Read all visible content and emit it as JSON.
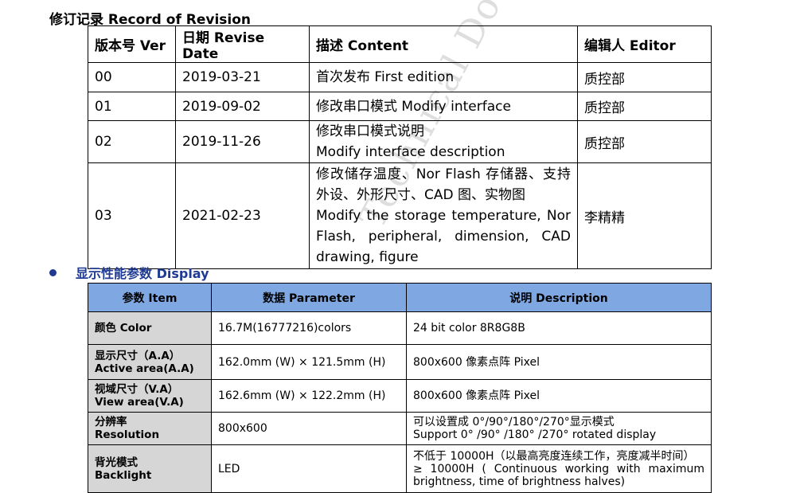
{
  "revision": {
    "title": "修订记录 Record of Revision",
    "headers": [
      "版本号 Ver",
      "日期 Revise Date",
      "描述 Content",
      "编辑人 Editor"
    ],
    "rows": [
      {
        "ver": "00",
        "date": "2019-03-21",
        "content": [
          "首次发布 First edition"
        ],
        "editor": "质控部"
      },
      {
        "ver": "01",
        "date": "2019-09-02",
        "content": [
          "修改串口模式 Modify interface"
        ],
        "editor": "质控部"
      },
      {
        "ver": "02",
        "date": "2019-11-26",
        "content": [
          "修改串口模式说明",
          "Modify interface description"
        ],
        "editor": "质控部"
      },
      {
        "ver": "03",
        "date": "2021-02-23",
        "content": [
          "修改储存温度、Nor Flash 存储器、支持外设、外形尺寸、CAD 图、实物图",
          "Modify the storage temperature, Nor Flash, peripheral, dimension, CAD drawing, figure"
        ],
        "editor": "李精精"
      }
    ]
  },
  "display": {
    "title": "显示性能参数 Display",
    "headers": [
      "参数 Item",
      "数据 Parameter",
      "说明 Description"
    ],
    "rows": [
      {
        "item": [
          "颜色 Color"
        ],
        "param": "16.7M(16777216)colors",
        "desc": [
          "24 bit color 8R8G8B"
        ]
      },
      {
        "item": [
          "显示尺寸（A.A）",
          "Active area(A.A)"
        ],
        "param": "162.0mm (W) × 121.5mm (H)",
        "desc": [
          "800x600 像素点阵 Pixel"
        ]
      },
      {
        "item": [
          "视域尺寸（V.A）",
          "View area(V.A)"
        ],
        "param": "162.6mm (W) × 122.2mm (H)",
        "desc": [
          "800x600 像素点阵 Pixel"
        ]
      },
      {
        "item": [
          "分辨率",
          "Resolution"
        ],
        "param": "800x600",
        "desc": [
          "可以设置成 0°/90°/180°/270°显示模式",
          "Support 0° /90° /180° /270° rotated display"
        ]
      },
      {
        "item": [
          "背光模式",
          "Backlight"
        ],
        "param": "LED",
        "desc": [
          "不低于 10000H（以最高亮度连续工作，亮度减半时间）",
          "≥ 10000H ( Continuous working with maximum brightness, time of brightness halves)"
        ]
      }
    ]
  },
  "watermark": "Technical Document"
}
